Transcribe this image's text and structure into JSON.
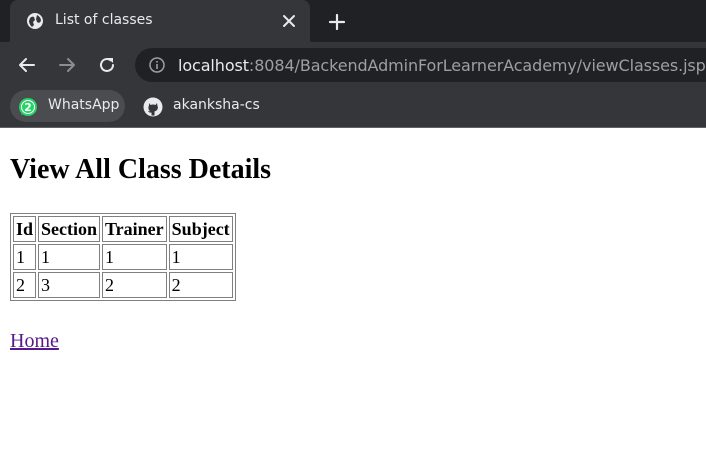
{
  "browser": {
    "tab": {
      "title": "List of classes",
      "favicon": "globe-icon"
    },
    "address_bar": {
      "host": "localhost",
      "rest": ":8084/BackendAdminForLearnerAcademy/viewClasses.jsp"
    },
    "bookmarks": [
      {
        "label": "WhatsApp",
        "icon": "whatsapp-icon",
        "badge": "2"
      },
      {
        "label": "akanksha-cs",
        "icon": "github-icon"
      }
    ]
  },
  "page": {
    "heading": "View All Class Details",
    "table": {
      "headers": [
        "Id",
        "Section",
        "Trainer",
        "Subject"
      ],
      "rows": [
        [
          "1",
          "1",
          "1",
          "1"
        ],
        [
          "2",
          "3",
          "2",
          "2"
        ]
      ]
    },
    "home_link": "Home"
  },
  "colors": {
    "tab_strip": "#202124",
    "toolbar": "#35363a",
    "visited_link": "#551a8b"
  }
}
